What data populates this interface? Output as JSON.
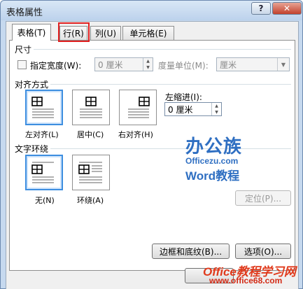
{
  "window": {
    "title": "表格属性"
  },
  "tabs": [
    {
      "label": "表格(T)",
      "active": true
    },
    {
      "label": "行(R)",
      "active": false
    },
    {
      "label": "列(U)",
      "active": false
    },
    {
      "label": "单元格(E)",
      "active": false
    }
  ],
  "size": {
    "heading": "尺寸",
    "preferred_width_label": "指定宽度(W):",
    "preferred_width_checked": false,
    "width_value": "0 厘米",
    "measure_label": "度量单位(M):",
    "measure_value": "厘米"
  },
  "alignment": {
    "heading": "对齐方式",
    "options": [
      {
        "label": "左对齐(L)",
        "selected": true
      },
      {
        "label": "居中(C)",
        "selected": false
      },
      {
        "label": "右对齐(H)",
        "selected": false
      }
    ],
    "indent_label": "左缩进(I):",
    "indent_value": "0 厘米"
  },
  "wrapping": {
    "heading": "文字环绕",
    "options": [
      {
        "label": "无(N)",
        "selected": true
      },
      {
        "label": "环绕(A)",
        "selected": false
      }
    ],
    "position_button": "定位(P)..."
  },
  "footer": {
    "borders_button": "边框和底纹(B)...",
    "options_button": "选项(O)..."
  },
  "watermarks": {
    "logo_cn": "办公族",
    "logo_url": "Officezu.com",
    "logo_word": "Word教程",
    "bottom_brand": "Office教程学习网",
    "bottom_url": "www.office68.com"
  },
  "colors": {
    "accent": "#3d8ee0",
    "highlight_red": "#e02020"
  }
}
